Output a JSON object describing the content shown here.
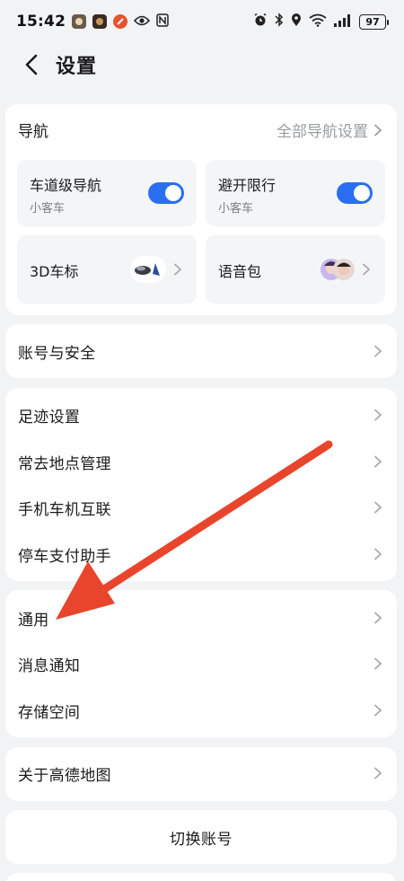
{
  "status_bar": {
    "time": "15:42",
    "battery": "97"
  },
  "header": {
    "title": "设置"
  },
  "navigation": {
    "heading": "导航",
    "all_settings": "全部导航设置",
    "tiles": [
      {
        "title": "车道级导航",
        "subtitle": "小客车",
        "toggle": "on"
      },
      {
        "title": "避开限行",
        "subtitle": "小客车",
        "toggle": "on"
      },
      {
        "title": "3D车标"
      },
      {
        "title": "语音包"
      }
    ]
  },
  "groups": {
    "account": [
      "账号与安全"
    ],
    "footprint": [
      "足迹设置",
      "常去地点管理",
      "手机车机互联",
      "停车支付助手"
    ],
    "general": [
      "通用",
      "消息通知",
      "存储空间"
    ],
    "about": [
      "关于高德地图"
    ]
  },
  "switch_account": "切换账号",
  "colors": {
    "accent": "#2a6ef1",
    "annotation": "#e8452c",
    "background": "#f2f3f5"
  }
}
